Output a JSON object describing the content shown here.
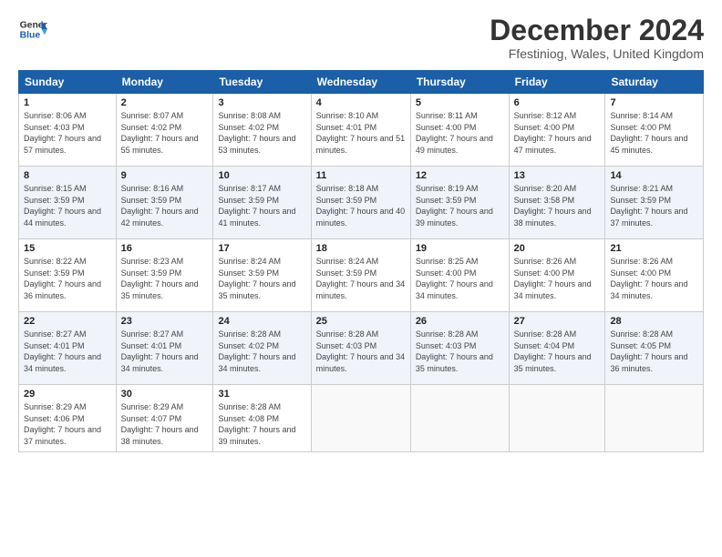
{
  "header": {
    "logo_line1": "General",
    "logo_line2": "Blue",
    "month_title": "December 2024",
    "location": "Ffestiniog, Wales, United Kingdom"
  },
  "weekdays": [
    "Sunday",
    "Monday",
    "Tuesday",
    "Wednesday",
    "Thursday",
    "Friday",
    "Saturday"
  ],
  "weeks": [
    [
      {
        "day": "1",
        "sunrise": "Sunrise: 8:06 AM",
        "sunset": "Sunset: 4:03 PM",
        "daylight": "Daylight: 7 hours and 57 minutes."
      },
      {
        "day": "2",
        "sunrise": "Sunrise: 8:07 AM",
        "sunset": "Sunset: 4:02 PM",
        "daylight": "Daylight: 7 hours and 55 minutes."
      },
      {
        "day": "3",
        "sunrise": "Sunrise: 8:08 AM",
        "sunset": "Sunset: 4:02 PM",
        "daylight": "Daylight: 7 hours and 53 minutes."
      },
      {
        "day": "4",
        "sunrise": "Sunrise: 8:10 AM",
        "sunset": "Sunset: 4:01 PM",
        "daylight": "Daylight: 7 hours and 51 minutes."
      },
      {
        "day": "5",
        "sunrise": "Sunrise: 8:11 AM",
        "sunset": "Sunset: 4:00 PM",
        "daylight": "Daylight: 7 hours and 49 minutes."
      },
      {
        "day": "6",
        "sunrise": "Sunrise: 8:12 AM",
        "sunset": "Sunset: 4:00 PM",
        "daylight": "Daylight: 7 hours and 47 minutes."
      },
      {
        "day": "7",
        "sunrise": "Sunrise: 8:14 AM",
        "sunset": "Sunset: 4:00 PM",
        "daylight": "Daylight: 7 hours and 45 minutes."
      }
    ],
    [
      {
        "day": "8",
        "sunrise": "Sunrise: 8:15 AM",
        "sunset": "Sunset: 3:59 PM",
        "daylight": "Daylight: 7 hours and 44 minutes."
      },
      {
        "day": "9",
        "sunrise": "Sunrise: 8:16 AM",
        "sunset": "Sunset: 3:59 PM",
        "daylight": "Daylight: 7 hours and 42 minutes."
      },
      {
        "day": "10",
        "sunrise": "Sunrise: 8:17 AM",
        "sunset": "Sunset: 3:59 PM",
        "daylight": "Daylight: 7 hours and 41 minutes."
      },
      {
        "day": "11",
        "sunrise": "Sunrise: 8:18 AM",
        "sunset": "Sunset: 3:59 PM",
        "daylight": "Daylight: 7 hours and 40 minutes."
      },
      {
        "day": "12",
        "sunrise": "Sunrise: 8:19 AM",
        "sunset": "Sunset: 3:59 PM",
        "daylight": "Daylight: 7 hours and 39 minutes."
      },
      {
        "day": "13",
        "sunrise": "Sunrise: 8:20 AM",
        "sunset": "Sunset: 3:58 PM",
        "daylight": "Daylight: 7 hours and 38 minutes."
      },
      {
        "day": "14",
        "sunrise": "Sunrise: 8:21 AM",
        "sunset": "Sunset: 3:59 PM",
        "daylight": "Daylight: 7 hours and 37 minutes."
      }
    ],
    [
      {
        "day": "15",
        "sunrise": "Sunrise: 8:22 AM",
        "sunset": "Sunset: 3:59 PM",
        "daylight": "Daylight: 7 hours and 36 minutes."
      },
      {
        "day": "16",
        "sunrise": "Sunrise: 8:23 AM",
        "sunset": "Sunset: 3:59 PM",
        "daylight": "Daylight: 7 hours and 35 minutes."
      },
      {
        "day": "17",
        "sunrise": "Sunrise: 8:24 AM",
        "sunset": "Sunset: 3:59 PM",
        "daylight": "Daylight: 7 hours and 35 minutes."
      },
      {
        "day": "18",
        "sunrise": "Sunrise: 8:24 AM",
        "sunset": "Sunset: 3:59 PM",
        "daylight": "Daylight: 7 hours and 34 minutes."
      },
      {
        "day": "19",
        "sunrise": "Sunrise: 8:25 AM",
        "sunset": "Sunset: 4:00 PM",
        "daylight": "Daylight: 7 hours and 34 minutes."
      },
      {
        "day": "20",
        "sunrise": "Sunrise: 8:26 AM",
        "sunset": "Sunset: 4:00 PM",
        "daylight": "Daylight: 7 hours and 34 minutes."
      },
      {
        "day": "21",
        "sunrise": "Sunrise: 8:26 AM",
        "sunset": "Sunset: 4:00 PM",
        "daylight": "Daylight: 7 hours and 34 minutes."
      }
    ],
    [
      {
        "day": "22",
        "sunrise": "Sunrise: 8:27 AM",
        "sunset": "Sunset: 4:01 PM",
        "daylight": "Daylight: 7 hours and 34 minutes."
      },
      {
        "day": "23",
        "sunrise": "Sunrise: 8:27 AM",
        "sunset": "Sunset: 4:01 PM",
        "daylight": "Daylight: 7 hours and 34 minutes."
      },
      {
        "day": "24",
        "sunrise": "Sunrise: 8:28 AM",
        "sunset": "Sunset: 4:02 PM",
        "daylight": "Daylight: 7 hours and 34 minutes."
      },
      {
        "day": "25",
        "sunrise": "Sunrise: 8:28 AM",
        "sunset": "Sunset: 4:03 PM",
        "daylight": "Daylight: 7 hours and 34 minutes."
      },
      {
        "day": "26",
        "sunrise": "Sunrise: 8:28 AM",
        "sunset": "Sunset: 4:03 PM",
        "daylight": "Daylight: 7 hours and 35 minutes."
      },
      {
        "day": "27",
        "sunrise": "Sunrise: 8:28 AM",
        "sunset": "Sunset: 4:04 PM",
        "daylight": "Daylight: 7 hours and 35 minutes."
      },
      {
        "day": "28",
        "sunrise": "Sunrise: 8:28 AM",
        "sunset": "Sunset: 4:05 PM",
        "daylight": "Daylight: 7 hours and 36 minutes."
      }
    ],
    [
      {
        "day": "29",
        "sunrise": "Sunrise: 8:29 AM",
        "sunset": "Sunset: 4:06 PM",
        "daylight": "Daylight: 7 hours and 37 minutes."
      },
      {
        "day": "30",
        "sunrise": "Sunrise: 8:29 AM",
        "sunset": "Sunset: 4:07 PM",
        "daylight": "Daylight: 7 hours and 38 minutes."
      },
      {
        "day": "31",
        "sunrise": "Sunrise: 8:28 AM",
        "sunset": "Sunset: 4:08 PM",
        "daylight": "Daylight: 7 hours and 39 minutes."
      },
      null,
      null,
      null,
      null
    ]
  ]
}
